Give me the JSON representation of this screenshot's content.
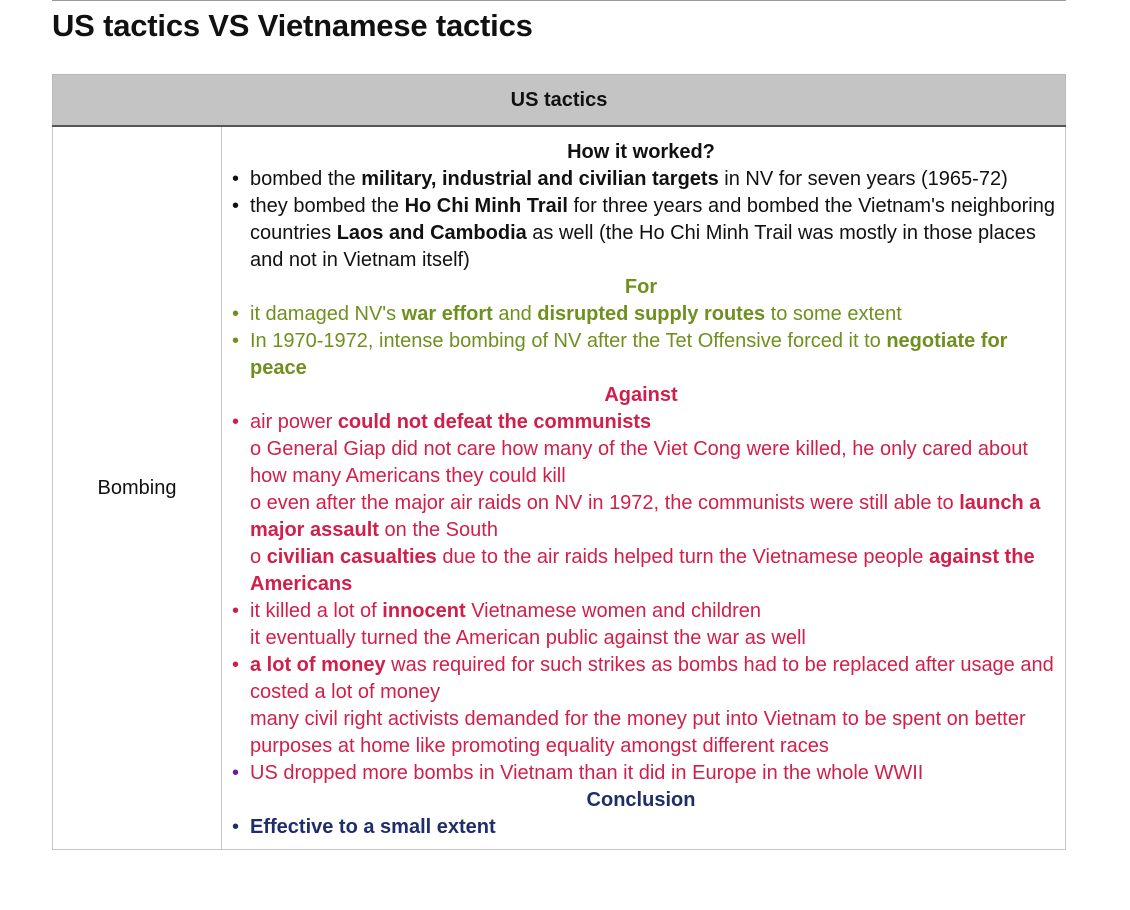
{
  "page_title": "US tactics VS Vietnamese tactics",
  "table": {
    "header": "US tactics",
    "row_label": "Bombing",
    "how_heading": "How it worked?",
    "how_items": [
      {
        "t1": "bombed the ",
        "b1": "military, industrial and civilian targets",
        "t2": " in NV for seven years (1965-72)"
      },
      {
        "t1": "they bombed the ",
        "b1": "Ho Chi Minh Trail",
        "t2": " for three years and bombed the Vietnam's neighboring countries ",
        "b2": "Laos and Cambodia",
        "t3": " as well (the Ho Chi Minh Trail was mostly in those places and not in Vietnam itself)"
      }
    ],
    "for_heading": "For",
    "for_items": [
      {
        "t1": "it damaged NV's ",
        "b1": "war effort",
        "t2": " and ",
        "b2": "disrupted supply routes",
        "t3": " to some extent"
      },
      {
        "t1": "In 1970-1972, intense bombing of NV after the Tet Offensive forced it to ",
        "b1": "negotiate for peace"
      }
    ],
    "against_heading": "Against",
    "against_items": [
      {
        "t1": "air power ",
        "b1": "could not defeat the communists",
        "subs": [
          {
            "t1": "o General Giap did not care how many of the Viet Cong were killed, he only cared about how many Americans they could kill"
          },
          {
            "t1": "o even after the major air raids on NV in 1972, the communists were still able to ",
            "b1": "launch a major assault",
            "t2": " on the South"
          },
          {
            "t1": "o ",
            "b1": "civilian casualties",
            "t2": " due to the air raids helped turn the Vietnamese people ",
            "b2": "against the Americans"
          }
        ]
      },
      {
        "t1": "it killed a lot of ",
        "b1": "innocent",
        "t2": " Vietnamese women and children",
        "t3": "it eventually turned the American public against the war as well"
      },
      {
        "b1": "a lot of money",
        "t1": " was required for such strikes as bombs had to be replaced after usage and costed a lot of money",
        "t2": "many civil right activists demanded for the money put into Vietnam to be spent on better purposes at home like promoting equality amongst different races"
      },
      {
        "t1": "US dropped more bombs in Vietnam than it did in Europe in the whole WWII"
      }
    ],
    "conclusion_heading": "Conclusion",
    "conclusion_items": [
      {
        "b1": "Effective to a small extent"
      }
    ],
    "bullet": "•",
    "colors": {
      "for": "#6f8f1e",
      "against": "#d11f4a",
      "last_bullet": "#6a1b9a",
      "conclusion": "#1f2d6b",
      "header_bg": "#c4c4c4"
    }
  }
}
